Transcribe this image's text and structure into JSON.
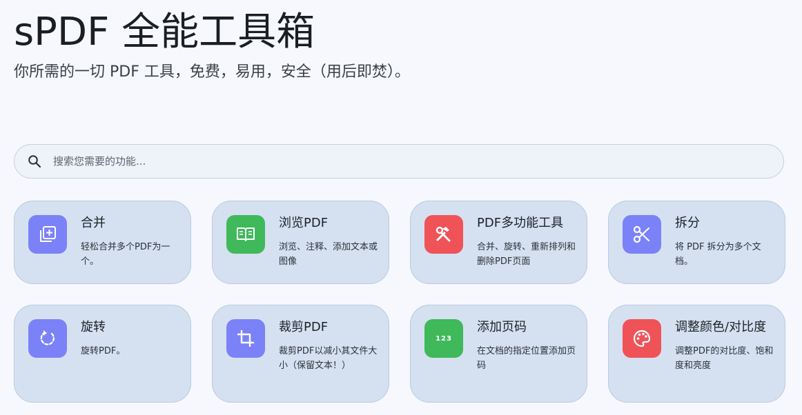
{
  "header": {
    "title": "sPDF 全能工具箱",
    "subtitle": "你所需的一切 PDF 工具，免费，易用，安全（用后即焚）。"
  },
  "search": {
    "placeholder": "搜索您需要的功能...",
    "icon": "search-icon"
  },
  "tools": [
    {
      "name": "合并",
      "desc": "轻松合并多个PDF为一个。",
      "icon": "merge-icon",
      "color": "#7b82f7"
    },
    {
      "name": "浏览PDF",
      "desc": "浏览、注释、添加文本或图像",
      "icon": "book-icon",
      "color": "#3fb95a"
    },
    {
      "name": "PDF多功能工具",
      "desc": "合并、旋转、重新排列和删除PDF页面",
      "icon": "tools-icon",
      "color": "#ef5358"
    },
    {
      "name": "拆分",
      "desc": "将 PDF 拆分为多个文档。",
      "icon": "scissors-icon",
      "color": "#7b82f7"
    },
    {
      "name": "旋转",
      "desc": "旋转PDF。",
      "icon": "rotate-icon",
      "color": "#7b82f7"
    },
    {
      "name": "裁剪PDF",
      "desc": "裁剪PDF以减小其文件大小（保留文本！）",
      "icon": "crop-icon",
      "color": "#7b82f7"
    },
    {
      "name": "添加页码",
      "desc": "在文档的指定位置添加页码",
      "icon": "page-numbers-icon",
      "color": "#3fb95a",
      "icon_text": "123"
    },
    {
      "name": "调整颜色/对比度",
      "desc": "调整PDF的对比度、饱和度和亮度",
      "icon": "palette-icon",
      "color": "#ef5358"
    }
  ]
}
